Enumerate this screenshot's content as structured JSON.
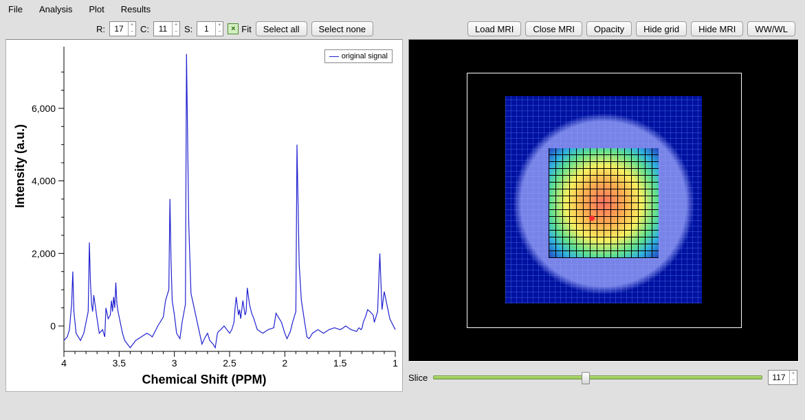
{
  "menu": {
    "file": "File",
    "analysis": "Analysis",
    "plot": "Plot",
    "results": "Results"
  },
  "toolbar": {
    "r_label": "R:",
    "r_value": "17",
    "c_label": "C:",
    "c_value": "11",
    "s_label": "S:",
    "s_value": "1",
    "fit": "Fit",
    "select_all": "Select all",
    "select_none": "Select none",
    "load_mri": "Load MRI",
    "close_mri": "Close MRI",
    "opacity": "Opacity",
    "hide_grid": "Hide grid",
    "hide_mri": "Hide MRI",
    "wwwl": "WW/WL"
  },
  "plot": {
    "legend": "original signal",
    "ylabel": "Intensity (a.u.)",
    "xlabel": "Chemical Shift (PPM)",
    "xticks": [
      "4",
      "3.5",
      "3",
      "2.5",
      "2",
      "1.5",
      "1"
    ],
    "yticks": [
      "0",
      "2,000",
      "4,000",
      "6,000"
    ]
  },
  "slice": {
    "label": "Slice",
    "value": "117",
    "min": 0,
    "max": 255,
    "pos_pct": 46
  },
  "chart_data": {
    "type": "line",
    "title": "",
    "xlabel": "Chemical Shift (PPM)",
    "ylabel": "Intensity (a.u.)",
    "xlim": [
      4,
      1
    ],
    "ylim": [
      -700,
      7700
    ],
    "series": [
      {
        "name": "original signal",
        "x": [
          4.0,
          3.97,
          3.95,
          3.93,
          3.92,
          3.91,
          3.89,
          3.87,
          3.85,
          3.82,
          3.8,
          3.78,
          3.77,
          3.76,
          3.75,
          3.74,
          3.73,
          3.7,
          3.68,
          3.65,
          3.63,
          3.62,
          3.6,
          3.58,
          3.57,
          3.56,
          3.55,
          3.54,
          3.53,
          3.52,
          3.51,
          3.47,
          3.45,
          3.4,
          3.35,
          3.3,
          3.25,
          3.22,
          3.2,
          3.15,
          3.1,
          3.08,
          3.05,
          3.04,
          3.03,
          3.02,
          3.0,
          2.98,
          2.95,
          2.93,
          2.9,
          2.89,
          2.87,
          2.85,
          2.75,
          2.72,
          2.7,
          2.68,
          2.65,
          2.63,
          2.61,
          2.6,
          2.58,
          2.55,
          2.5,
          2.48,
          2.46,
          2.45,
          2.44,
          2.42,
          2.41,
          2.4,
          2.38,
          2.37,
          2.36,
          2.35,
          2.34,
          2.32,
          2.3,
          2.28,
          2.25,
          2.2,
          2.15,
          2.1,
          2.08,
          2.05,
          2.03,
          2.0,
          1.98,
          1.95,
          1.93,
          1.9,
          1.89,
          1.87,
          1.85,
          1.83,
          1.81,
          1.8,
          1.78,
          1.75,
          1.7,
          1.65,
          1.6,
          1.55,
          1.5,
          1.47,
          1.45,
          1.4,
          1.35,
          1.33,
          1.31,
          1.3,
          1.29,
          1.27,
          1.25,
          1.23,
          1.2,
          1.19,
          1.18,
          1.16,
          1.14,
          1.12,
          1.1,
          1.05,
          1.0
        ],
        "values": [
          -400,
          -300,
          -100,
          600,
          1500,
          400,
          -200,
          -300,
          -400,
          -200,
          100,
          400,
          2300,
          1200,
          600,
          400,
          850,
          200,
          -200,
          -100,
          -300,
          500,
          200,
          300,
          700,
          400,
          800,
          500,
          1200,
          600,
          400,
          -200,
          -400,
          -600,
          -400,
          -300,
          -200,
          -250,
          -300,
          0,
          250,
          700,
          1000,
          3500,
          1800,
          700,
          300,
          -200,
          -350,
          100,
          600,
          7500,
          2800,
          900,
          -500,
          -300,
          -200,
          -400,
          -500,
          -600,
          -200,
          -150,
          -100,
          0,
          -200,
          -100,
          100,
          500,
          800,
          300,
          450,
          200,
          700,
          500,
          300,
          400,
          1050,
          600,
          350,
          200,
          -100,
          -200,
          -100,
          -50,
          350,
          200,
          100,
          -200,
          -350,
          -150,
          100,
          400,
          5000,
          1700,
          700,
          300,
          -100,
          -300,
          -350,
          -200,
          -100,
          -200,
          -100,
          -50,
          -100,
          -50,
          0,
          -100,
          -150,
          -50,
          -100,
          -50,
          100,
          250,
          450,
          400,
          300,
          100,
          200,
          400,
          2000,
          450,
          950,
          200,
          -100,
          -50
        ]
      }
    ]
  }
}
